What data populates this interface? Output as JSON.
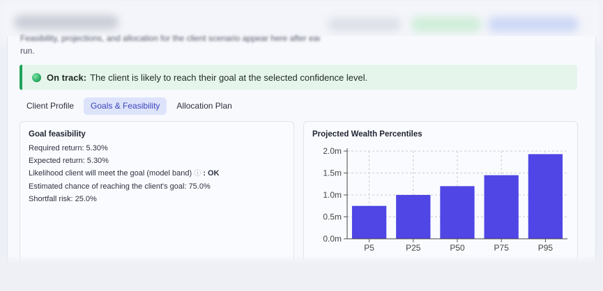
{
  "intro": {
    "text_partial": "Feasibility, projections, and allocation for the client scenario appear here after each",
    "text_run": "run."
  },
  "banner": {
    "status": "On track:",
    "message": "The client is likely to reach their goal at the selected confidence level.",
    "color": "#1ea35a"
  },
  "tabs": [
    {
      "label": "Client Profile",
      "active": false
    },
    {
      "label": "Goals & Feasibility",
      "active": true
    },
    {
      "label": "Allocation Plan",
      "active": false
    }
  ],
  "goal_feasibility": {
    "title": "Goal feasibility",
    "required_return": "Required return: 5.30%",
    "expected_return": "Expected return: 5.30%",
    "likelihood_label": "Likelihood client will meet the goal (model band)",
    "likelihood_icon": "info-icon",
    "likelihood_value": ": OK",
    "estimated_chance": "Estimated chance of reaching the client's goal: 75.0%",
    "shortfall_risk": "Shortfall risk: 25.0%"
  },
  "chart_data": {
    "type": "bar",
    "title": "Projected Wealth Percentiles",
    "categories": [
      "P5",
      "P25",
      "P50",
      "P75",
      "P95"
    ],
    "values": [
      0.75,
      1.0,
      1.2,
      1.45,
      1.93
    ],
    "ylim": [
      0,
      2.0
    ],
    "yticks": [
      0,
      0.5,
      1.0,
      1.5,
      2.0
    ],
    "ytick_labels": [
      "0.0m",
      "0.5m",
      "1.0m",
      "1.5m",
      "2.0m"
    ],
    "xlabel": "",
    "ylabel": "",
    "grid": true,
    "bar_color": "#4f46e5"
  }
}
